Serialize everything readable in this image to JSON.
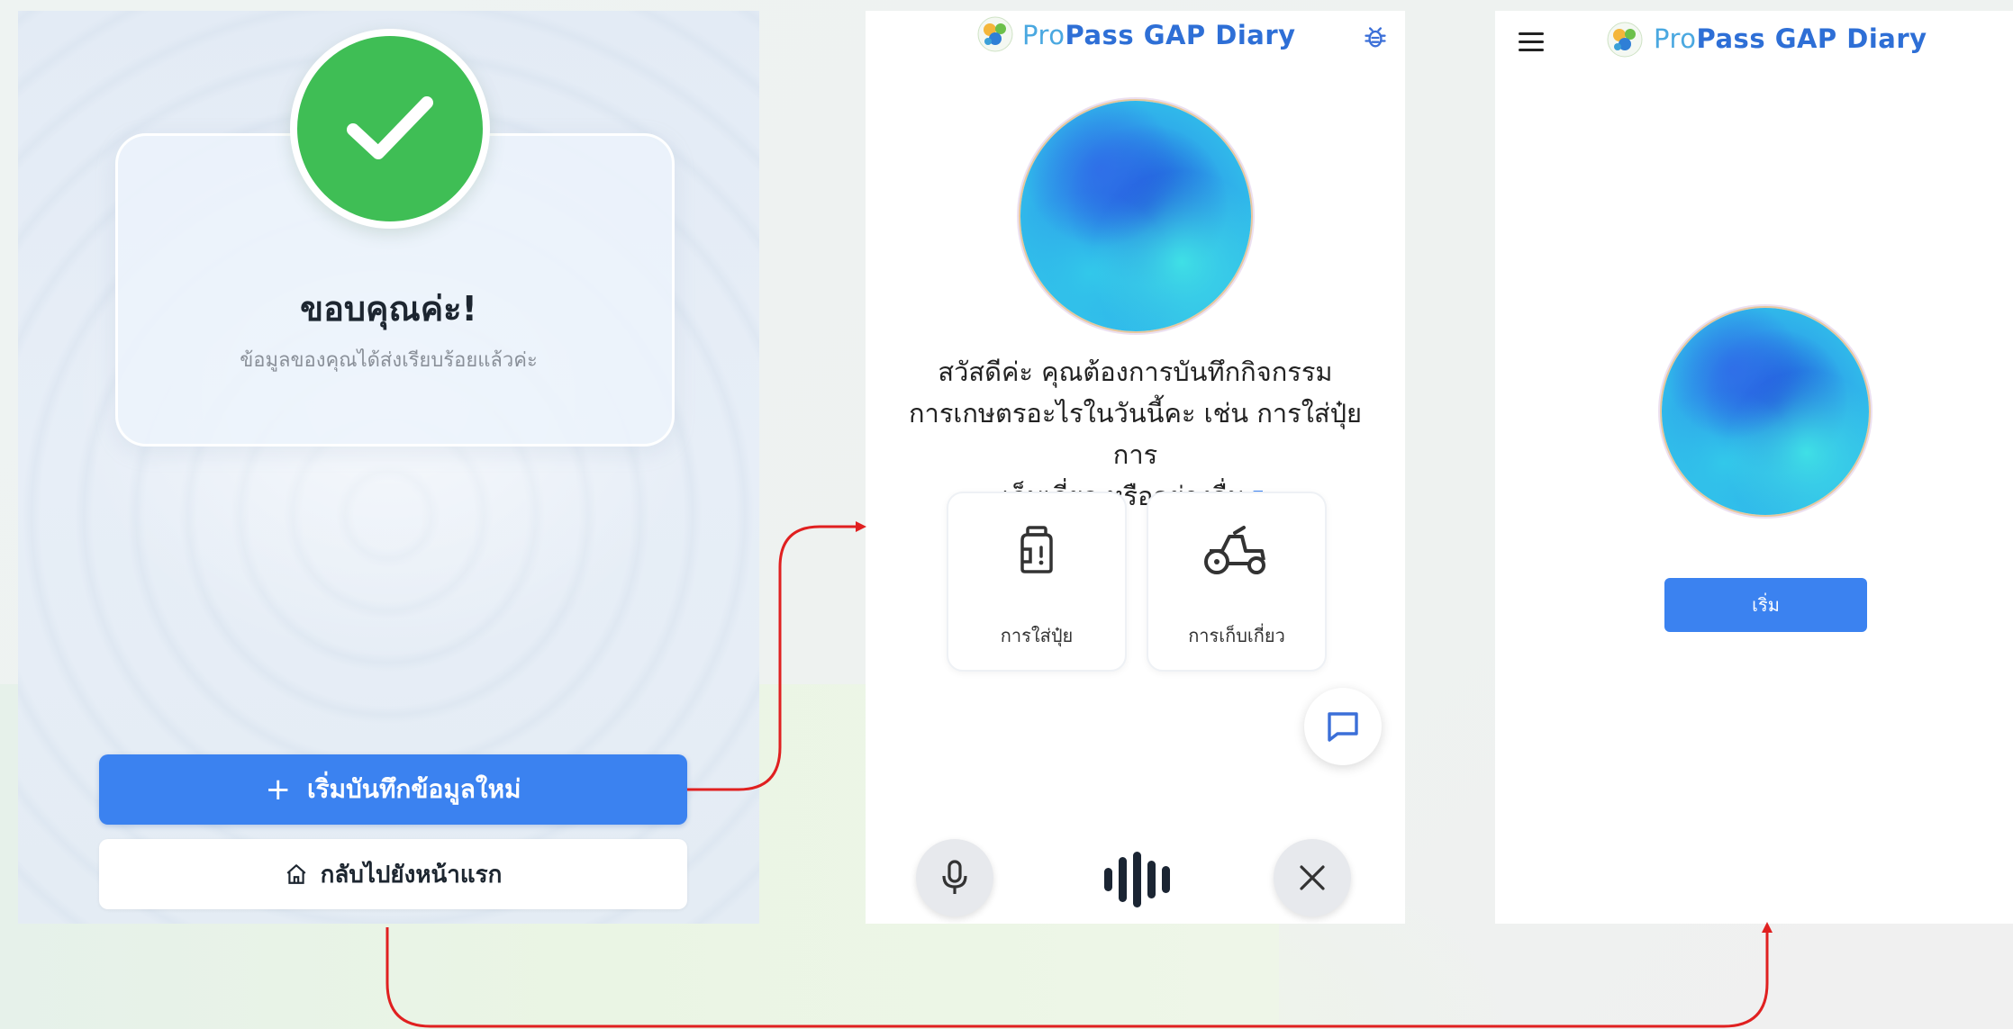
{
  "screen1": {
    "title": "ขอบคุณค่ะ!",
    "subtitle": "ข้อมูลของคุณได้ส่งเรียบร้อยแล้วค่ะ",
    "new_entry_button": "เริ่มบันทึกข้อมูลใหม่",
    "new_entry_icon": "plus-icon",
    "home_button": "กลับไปยังหน้าแรก",
    "home_icon": "home-icon",
    "success_icon": "check-icon",
    "success_color": "#3fbe55",
    "primary_color": "#3b82f0"
  },
  "screen2": {
    "brand_pro": "Pro",
    "brand_pass": "Pass",
    "brand_rest": " GAP Diary",
    "greeting_lines": [
      "สวัสดีค่ะ คุณต้องการบันทึกกิจกรรม",
      "การเกษตรอะไรในวันนี้คะ เช่น การใส่ปุ๋ย การ",
      "เก็บเกี่ยว หรืออย่างอื่น"
    ],
    "quick_actions": [
      {
        "label": "การใส่ปุ๋ย",
        "icon": "fertilizer-bottle-icon"
      },
      {
        "label": "การเก็บเกี่ยว",
        "icon": "tractor-icon"
      }
    ],
    "icons": [
      "bug-icon",
      "copy-icon",
      "chat-icon",
      "microphone-icon",
      "waveform-icon",
      "close-icon"
    ]
  },
  "screen3": {
    "brand_pro": "Pro",
    "brand_pass": "Pass",
    "brand_rest": " GAP Diary",
    "start_button": "เริ่ม",
    "menu_icon": "hamburger-menu-icon"
  },
  "flow": {
    "connector_color": "#e02020"
  }
}
